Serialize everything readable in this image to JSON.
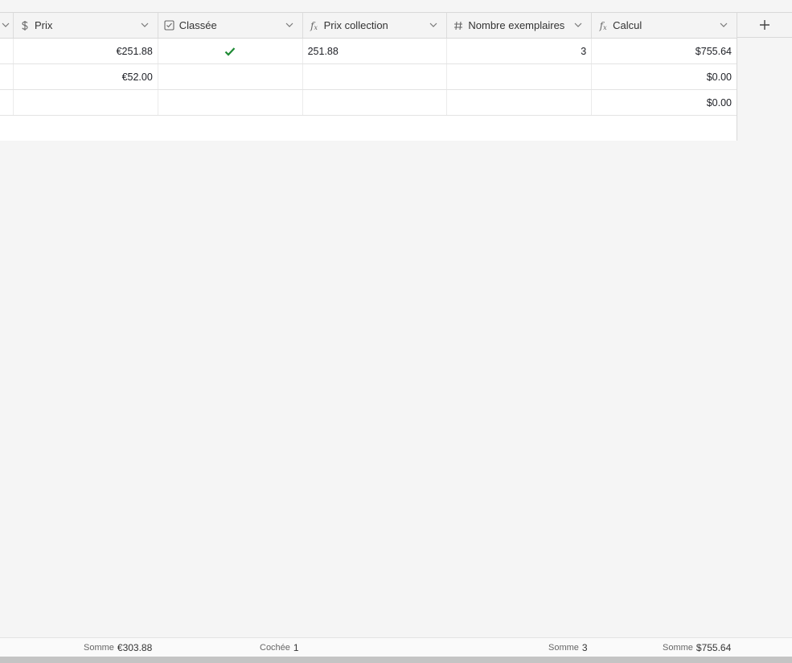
{
  "header": {
    "columns": [
      {
        "label": "Prix",
        "icon": "currency-dollar-icon"
      },
      {
        "label": "Classée",
        "icon": "checkbox-icon"
      },
      {
        "label": "Prix collection",
        "icon": "formula-icon"
      },
      {
        "label": "Nombre exemplaires",
        "icon": "number-hash-icon"
      },
      {
        "label": "Calcul",
        "icon": "formula-icon"
      }
    ]
  },
  "rows": [
    {
      "prix": "€251.88",
      "classee": true,
      "prix_collection": "251.88",
      "nombre": "3",
      "calcul": "$755.64"
    },
    {
      "prix": "€52.00",
      "classee": false,
      "prix_collection": "",
      "nombre": "",
      "calcul": "$0.00"
    },
    {
      "prix": "",
      "classee": false,
      "prix_collection": "",
      "nombre": "",
      "calcul": "$0.00"
    }
  ],
  "footer": {
    "prix": {
      "label": "Somme",
      "value": "€303.88"
    },
    "classee": {
      "label": "Cochée",
      "value": "1"
    },
    "nombre": {
      "label": "Somme",
      "value": "3"
    },
    "calcul": {
      "label": "Somme",
      "value": "$755.64"
    }
  },
  "colors": {
    "check_green": "#1e8a34"
  }
}
